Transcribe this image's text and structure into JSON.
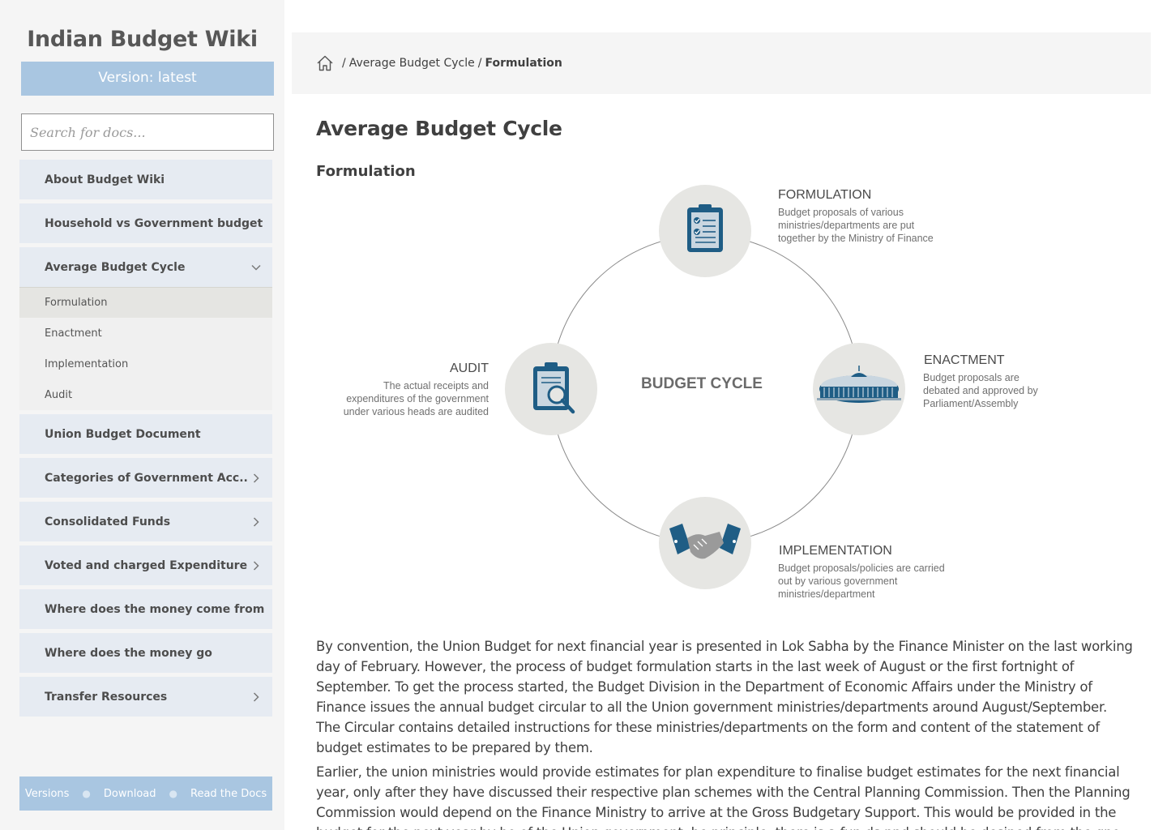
{
  "sidebar": {
    "site_title": "Indian Budget Wiki",
    "version_label": "Version: latest",
    "search_placeholder": "Search for docs...",
    "items": [
      {
        "label": "About Budget Wiki"
      },
      {
        "label": "Household vs Government budget"
      },
      {
        "label": "Average Budget Cycle",
        "expanded": true,
        "icon": "chevron-down-icon"
      },
      {
        "label": "Union Budget Document"
      },
      {
        "label": "Categories of Government Acc..",
        "icon": "chevron-right-icon"
      },
      {
        "label": "Consolidated Funds",
        "icon": "chevron-right-icon"
      },
      {
        "label": "Voted and charged Expenditure",
        "icon": "chevron-right-icon"
      },
      {
        "label": "Where does the money come from"
      },
      {
        "label": "Where does the money go"
      },
      {
        "label": "Transfer Resources",
        "icon": "chevron-right-icon"
      }
    ],
    "sub_items": [
      "Formulation",
      "Enactment",
      "Implementation",
      "Audit"
    ],
    "active_sub_item": "Formulation",
    "footer": {
      "versions": "Versions",
      "download": "Download",
      "read_the_docs": "Read the Docs"
    }
  },
  "breadcrumb": {
    "home_icon": "home-icon",
    "separator": "/",
    "parent": "Average Budget Cycle",
    "current": "Formulation"
  },
  "main": {
    "title": "Average Budget Cycle",
    "subtitle": "Formulation",
    "diagram": {
      "center_label": "BUDGET CYCLE",
      "stages": {
        "formulation": {
          "title": "FORMULATION",
          "desc": "Budget proposals of various ministries/departments are put together by the Ministry of Finance",
          "icon": "clipboard-checklist-icon"
        },
        "enactment": {
          "title": "ENACTMENT",
          "desc": "Budget proposals are debated and approved by Parliament/Assembly",
          "icon": "parliament-building-icon"
        },
        "implementation": {
          "title": "IMPLEMENTATION",
          "desc": "Budget proposals/policies are carried out by various government ministries/department",
          "icon": "handshake-icon"
        },
        "audit": {
          "title": "AUDIT",
          "desc": "The actual receipts and expenditures of the government under various heads are audited",
          "icon": "clipboard-magnifier-icon"
        }
      }
    },
    "paragraphs": [
      "By convention, the Union Budget for next financial year is presented in Lok Sabha by the Finance Minister on the last working day of February. However, the process of budget formulation starts in the last week of August or the first fortnight of September. To get the process started, the Budget Division in the Department of Economic Affairs under the Ministry of Finance issues the annual budget circular to all the Union government ministries/departments around August/September. The Circular contains detailed instructions for these ministries/departments on the form and content of the statement of budget estimates to be prepared by them.",
      "Earlier, the union ministries would provide estimates for plan expenditure to finalise budget estimates for the next financial year, only after they have discussed their respective plan schemes with the Central Planning Commission. Then the Planning Commission would depend on the Finance Ministry to arrive at the Gross Budgetary Support. This would be provided in the budget for the next year by bo of the Union government, he princinle, there is a fun ds nnd should be desined from the gno, nnd"
    ]
  },
  "colors": {
    "accent_blue": "#1f5d85",
    "sidebar_bg": "#f5f5f5",
    "nav_item_bg": "#e6ebf2",
    "version_bg": "#a9c6e1",
    "icon_circle_bg": "#e6e6e3"
  }
}
